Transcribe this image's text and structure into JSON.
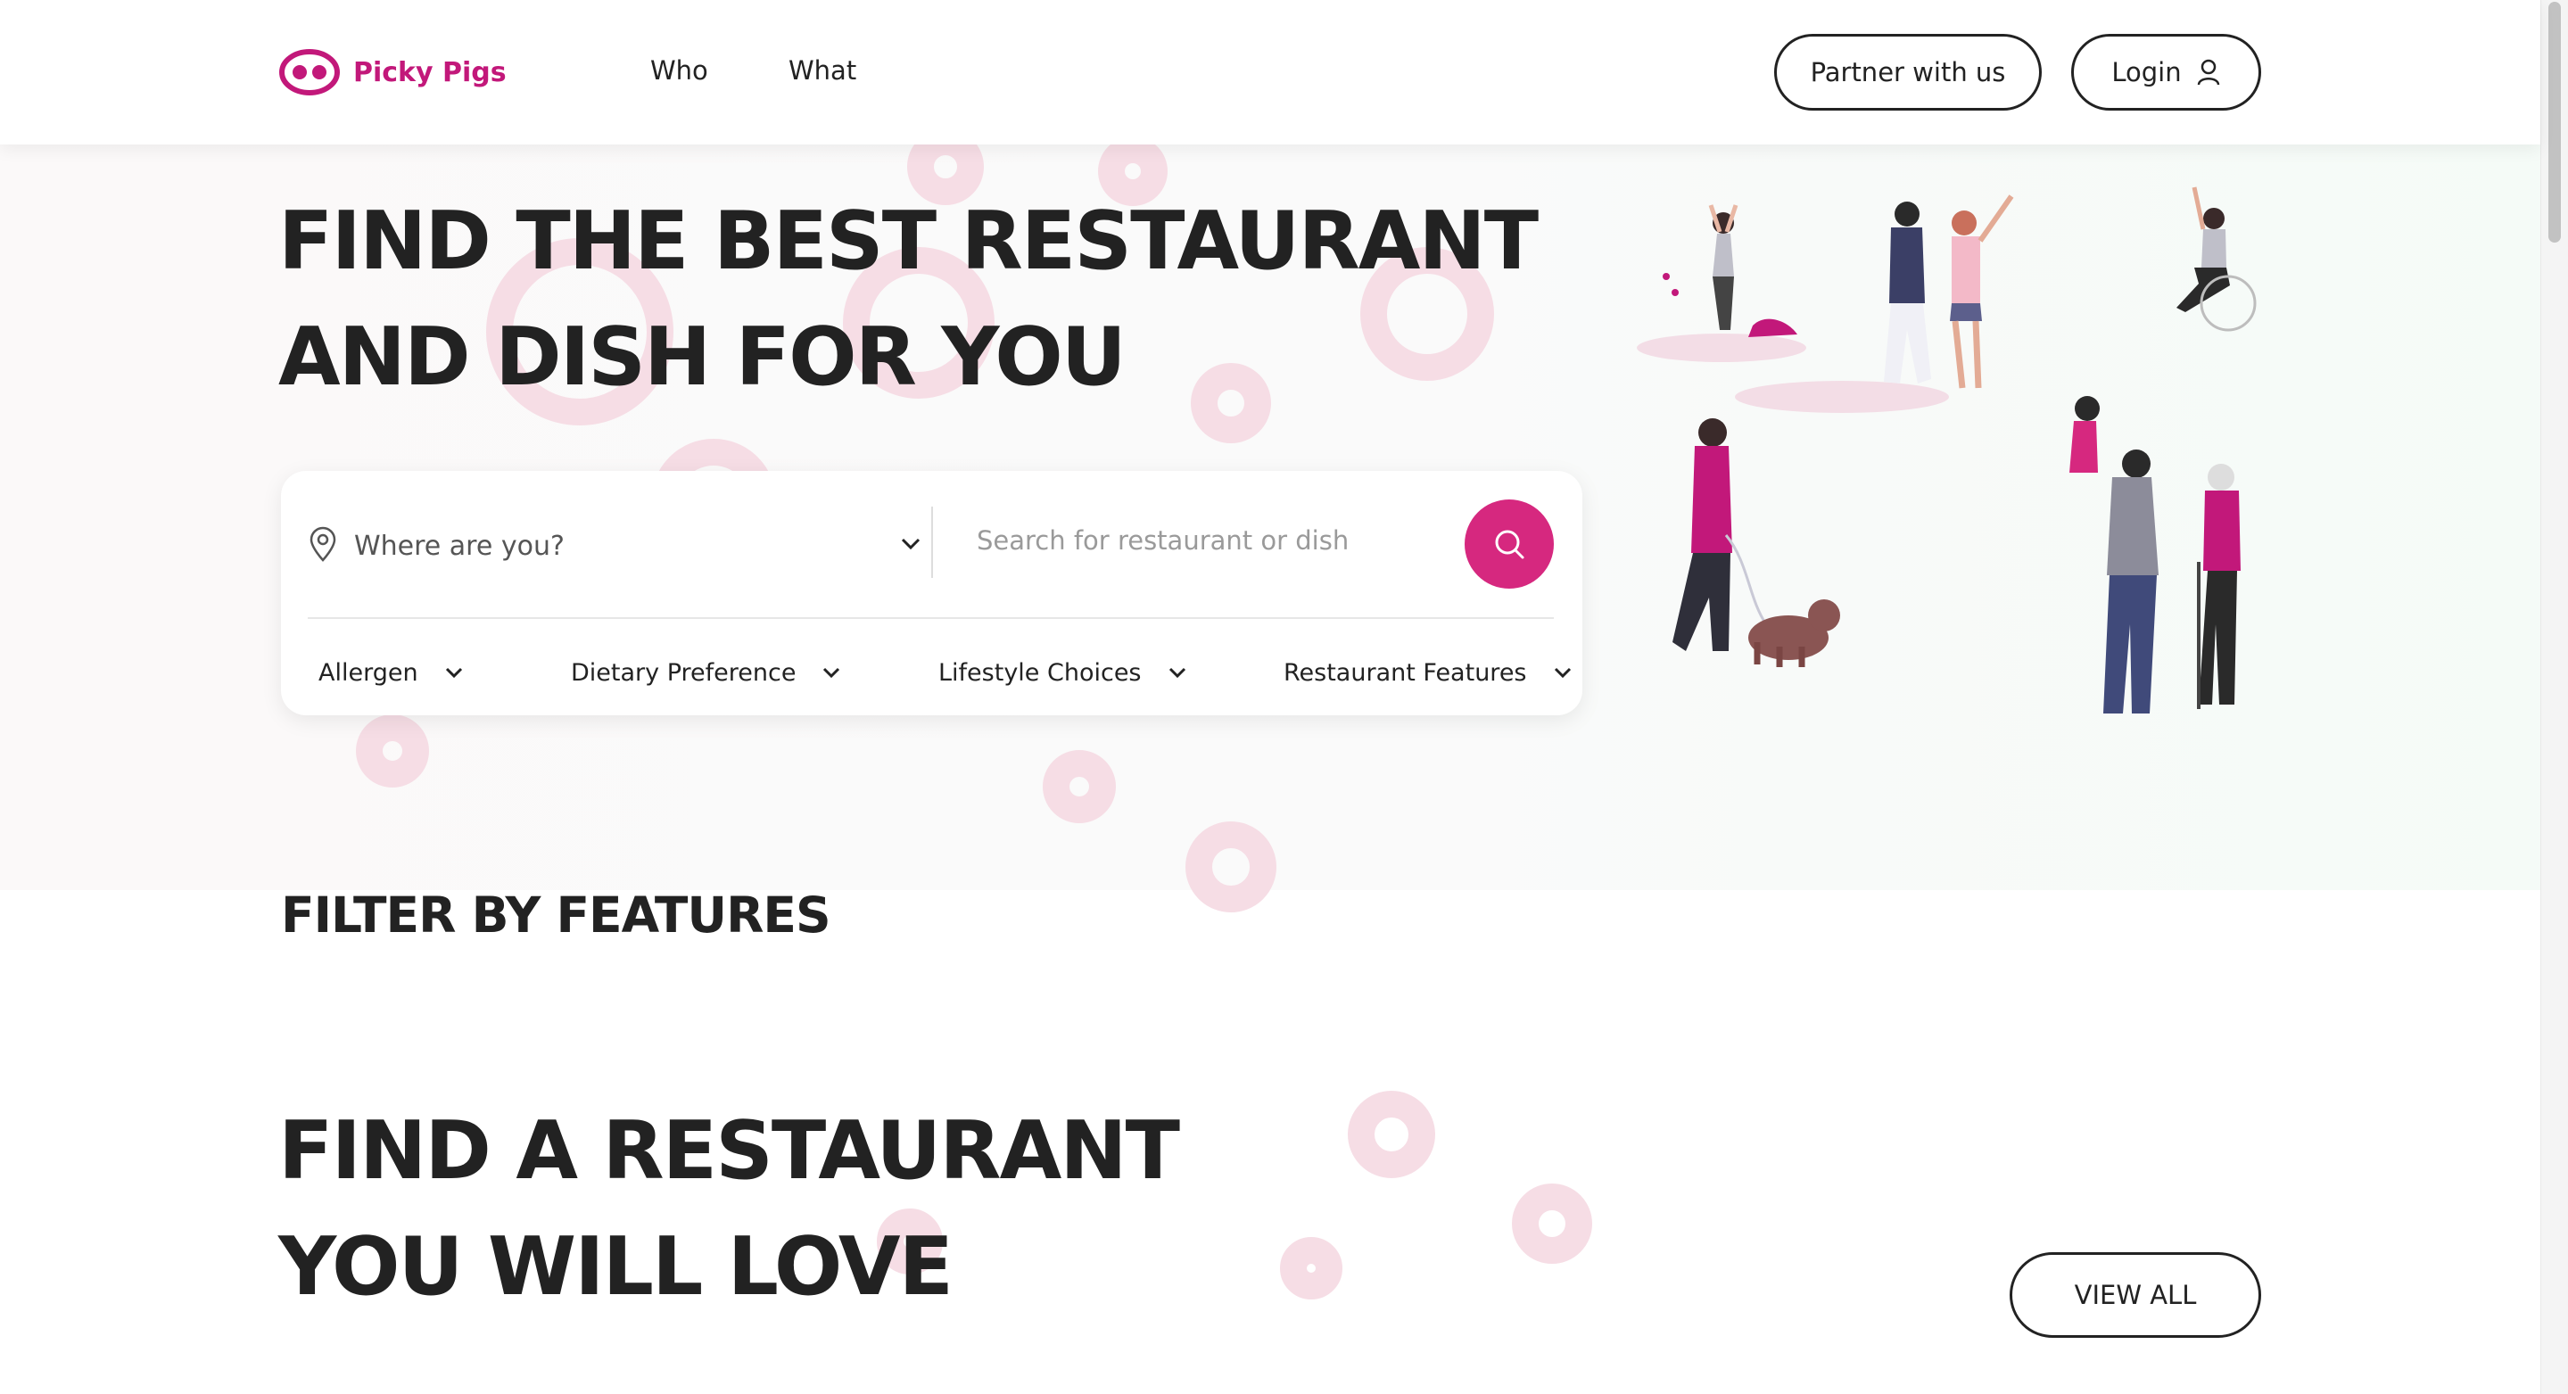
{
  "header": {
    "brand": "Picky Pigs",
    "nav": [
      "Who",
      "What"
    ],
    "partner_label": "Partner with us",
    "login_label": "Login"
  },
  "hero": {
    "title_line1": "FIND THE BEST RESTAURANT",
    "title_line2": "AND DISH FOR YOU"
  },
  "search": {
    "location_placeholder": "Where are you?",
    "dish_placeholder": "Search for restaurant or dish",
    "filters": [
      "Allergen",
      "Dietary Preference",
      "Lifestyle Choices",
      "Restaurant Features"
    ]
  },
  "features": {
    "title": "FILTER BY FEATURES"
  },
  "restaurants": {
    "title_line1": "FIND A RESTAURANT",
    "title_line2": "YOU WILL LOVE",
    "view_all_label": "VIEW ALL"
  },
  "colors": {
    "brand": "#c2187a",
    "accent": "#d6287f",
    "text": "#222222"
  }
}
